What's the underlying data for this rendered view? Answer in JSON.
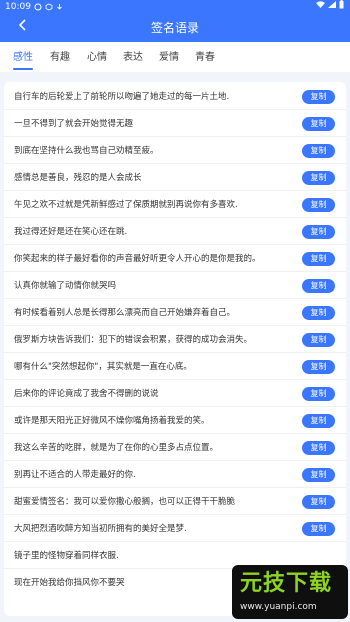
{
  "status_bar": {
    "time": "10:09"
  },
  "header": {
    "title": "签名语录",
    "back_icon": "arrow-left-icon"
  },
  "colors": {
    "primary": "#3a76ff",
    "background": "#f1f4fb"
  },
  "tabs": [
    {
      "label": "感性",
      "active": true
    },
    {
      "label": "有趣",
      "active": false
    },
    {
      "label": "心情",
      "active": false
    },
    {
      "label": "表达",
      "active": false
    },
    {
      "label": "爱情",
      "active": false
    },
    {
      "label": "青春",
      "active": false
    }
  ],
  "copy_label": "复制",
  "quotes": [
    "自行车的后轮爱上了前轮所以吻遍了她走过的每一片土地.",
    "一旦不得到了就会开始觉得无趣",
    "到底在坚持什么我也骂自己劝精至疲。",
    "感情总是善良，残忍的是人会成长",
    "午见之欢不过就是凭新鲜感过了保质期就别再说你有多喜欢.",
    "我过得还好是还在笑心还在跳.",
    "你笑起来的样子最好看你的声音最好听更令人开心的是你是我的。",
    "认真你就输了动情你就哭吗",
    "有时候看着别人总是长得那么漂亮而自己开始嫌弃着自己。",
    "俄罗斯方块告诉我们：犯下的错误会积累，获得的成功会消失。",
    "哪有什么\"突然想起你\"，其实就是一直在心底。",
    "后来你的评论竟成了我舍不得删的说说",
    "或许是那天阳光正好微风不燥你嘴角扬着我爱的笑。",
    "我这么辛苦的吃胖，就是为了在你的心里多占点位置。",
    "别再让不适合的人带走最好的你.",
    "甜蜜爱情签名：我可以爱你撒心般搁，也可以正得干干脆脆",
    "大风把烈酒吹醉方知当初所拥有的美好全是梦.",
    "镜子里的怪物穿着同样衣服.",
    "现在开始我给你挡风你不要哭"
  ],
  "watermark": {
    "name": "元技下载",
    "url": "www.yuanpi.com"
  }
}
